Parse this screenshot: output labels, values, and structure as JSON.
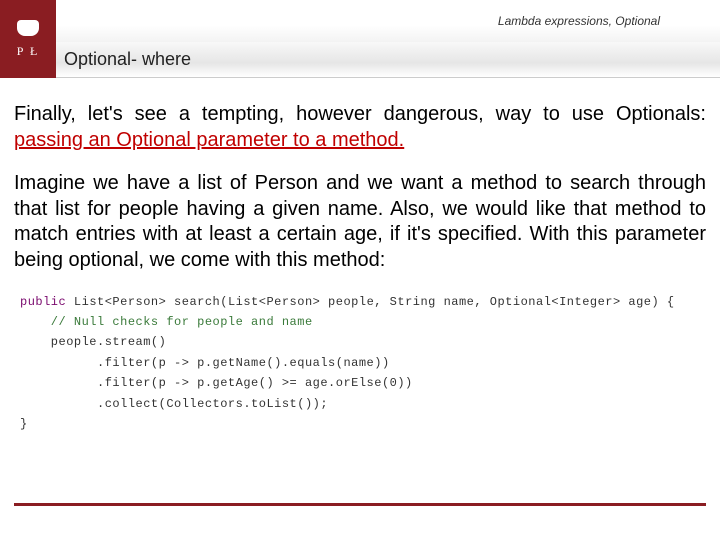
{
  "header": {
    "breadcrumb": "Lambda expressions, Optional",
    "logo_letters": "P   Ł"
  },
  "section": {
    "title": "Optional- where"
  },
  "paragraphs": {
    "p1_a": "Finally, let's see a tempting, however dangerous, way to use Optionals: ",
    "p1_b": "passing an Optional parameter to a method.",
    "p2": "Imagine we have a list of Person and we want a method to search through that list for people having a given name. Also, we would like that method to match entries with at least a certain age, if it's specified. With this parameter being optional, we come with this method:"
  },
  "code": {
    "kw_public": "public",
    "sig_rest": " List<Person> search(List<Person> people, String name, Optional<Integer> age) {",
    "comment": "    // Null checks for people and name",
    "l3": "    people.stream()",
    "l4": "          .filter(p -> p.getName().equals(name))",
    "l5": "          .filter(p -> p.getAge() >= age.orElse(0))",
    "l6": "          .collect(Collectors.toList());",
    "l7": "}"
  }
}
